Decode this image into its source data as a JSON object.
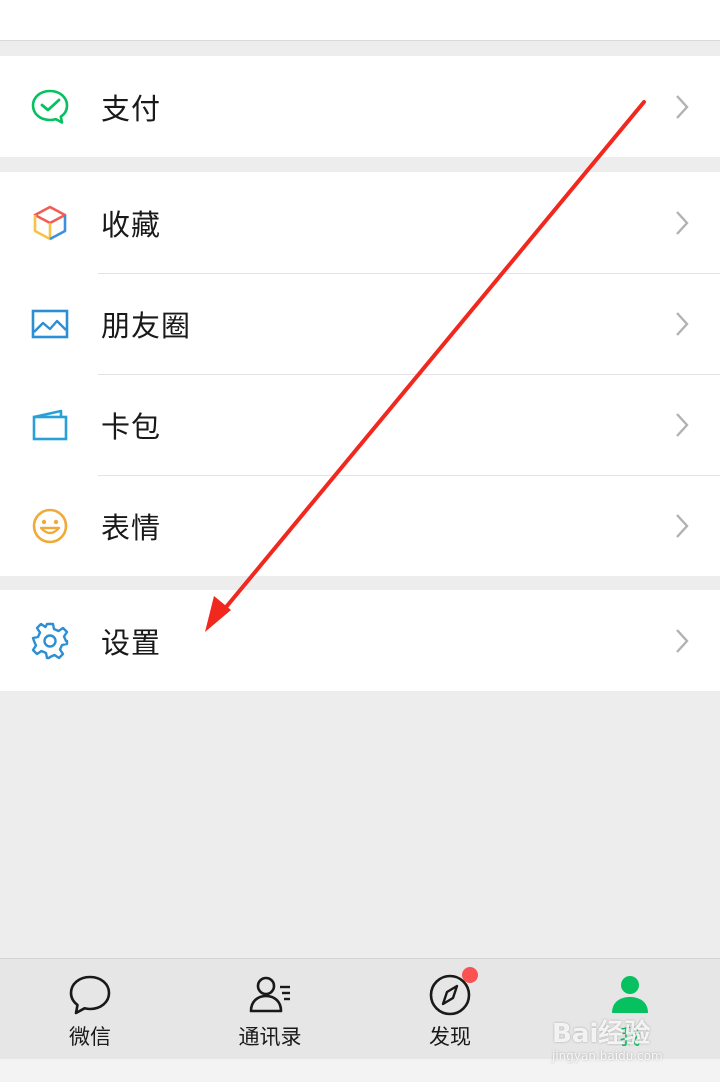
{
  "menu": {
    "group1": [
      {
        "label": "支付",
        "icon": "pay-icon"
      }
    ],
    "group2": [
      {
        "label": "收藏",
        "icon": "favorites-cube-icon"
      },
      {
        "label": "朋友圈",
        "icon": "moments-picture-icon"
      },
      {
        "label": "卡包",
        "icon": "card-wallet-icon"
      },
      {
        "label": "表情",
        "icon": "sticker-smile-icon"
      }
    ],
    "group3": [
      {
        "label": "设置",
        "icon": "gear-icon"
      }
    ]
  },
  "tabbar": {
    "tabs": [
      {
        "label": "微信",
        "icon": "chat-bubble-icon",
        "active": false
      },
      {
        "label": "通讯录",
        "icon": "contacts-icon",
        "active": false
      },
      {
        "label": "发现",
        "icon": "compass-icon",
        "active": false,
        "badge": true
      },
      {
        "label": "我",
        "icon": "me-person-icon",
        "active": true
      }
    ]
  },
  "watermark": {
    "text": "Bai经验",
    "sub": "jingyan.baidu.com"
  },
  "colors": {
    "accent_green": "#07c160",
    "badge_red": "#fa5151",
    "arrow_red": "#f0281e",
    "background": "#ededed"
  }
}
